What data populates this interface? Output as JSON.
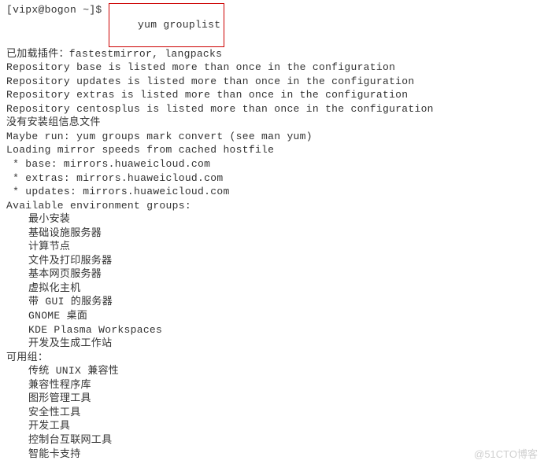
{
  "prompt": {
    "user_host": "[vipx@bogon ~]$ ",
    "command": "yum grouplist"
  },
  "messages": {
    "loaded_plugins": "已加载插件：fastestmirror, langpacks",
    "repo_base": "Repository base is listed more than once in the configuration",
    "repo_updates": "Repository updates is listed more than once in the configuration",
    "repo_extras": "Repository extras is listed more than once in the configuration",
    "repo_centosplus": "Repository centosplus is listed more than once in the configuration",
    "no_group_info": "没有安装组信息文件",
    "maybe_run": "Maybe run: yum groups mark convert (see man yum)",
    "loading_mirror": "Loading mirror speeds from cached hostfile",
    "mirror_base": " * base: mirrors.huaweicloud.com",
    "mirror_extras": " * extras: mirrors.huaweicloud.com",
    "mirror_updates": " * updates: mirrors.huaweicloud.com"
  },
  "env_groups_header": "Available environment groups:",
  "env_groups": {
    "g0": "最小安装",
    "g1": "基础设施服务器",
    "g2": "计算节点",
    "g3": "文件及打印服务器",
    "g4": "基本网页服务器",
    "g5": "虚拟化主机",
    "g6": "带 GUI 的服务器",
    "g7": "GNOME 桌面",
    "g8": "KDE Plasma Workspaces",
    "g9": "开发及生成工作站"
  },
  "avail_groups_header": "可用组：",
  "avail_groups": {
    "a0": "传统 UNIX 兼容性",
    "a1": "兼容性程序库",
    "a2": "图形管理工具",
    "a3": "安全性工具",
    "a4": "开发工具",
    "a5": "控制台互联网工具",
    "a6": "智能卡支持"
  },
  "watermark": "@51CTO博客"
}
